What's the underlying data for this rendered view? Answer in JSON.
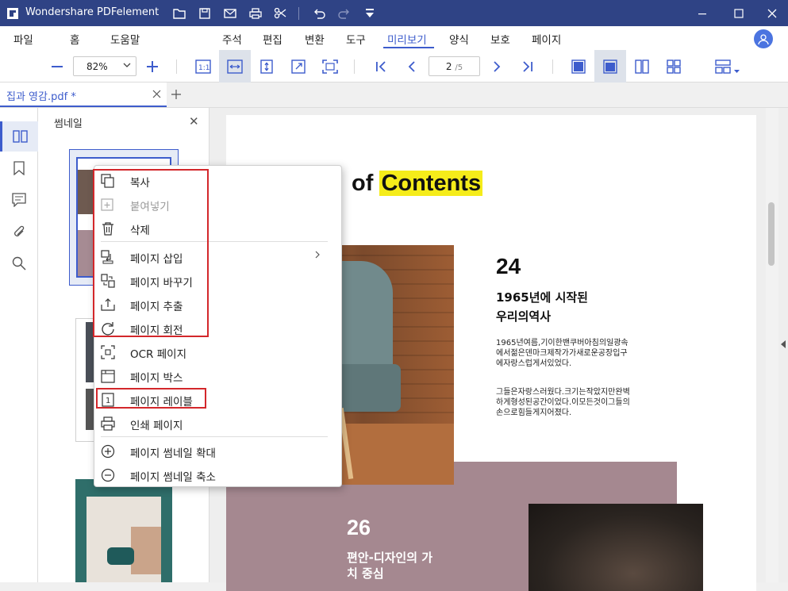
{
  "app": {
    "title": "Wondershare PDFelement"
  },
  "menu": {
    "items": [
      "파일",
      "홈",
      "도움말",
      "주석",
      "편집",
      "변환",
      "도구",
      "미리보기",
      "양식",
      "보호",
      "페이지"
    ],
    "active": "미리보기"
  },
  "toolbar": {
    "zoom": "82%",
    "page_current": "2",
    "page_total": "/5"
  },
  "tab": {
    "label": "집과 영감.pdf *"
  },
  "panel": {
    "title": "썸네일"
  },
  "context_menu": {
    "copy": "복사",
    "paste": "붙여넣기",
    "delete": "삭제",
    "insert": "페이지 삽입",
    "replace": "페이지 바꾸기",
    "extract": "페이지 추출",
    "rotate": "페이지 회전",
    "ocr": "OCR 페이지",
    "box": "페이지 박스",
    "label": "페이지 레이블",
    "print": "인쇄 페이지",
    "enlarge": "페이지 썸네일 확대",
    "shrink": "페이지 썸네일 축소"
  },
  "document": {
    "heading_prefix": "of",
    "heading_highlight": "Contents",
    "s1_num": "24",
    "s1_title_1": "1965년에 시작된",
    "s1_title_2": "우리의역사",
    "s1_p1": "1965년여름,기이한밴쿠버아침의일광속에서젊은덴마크제작가가새로운공장입구에자랑스럽게서있었다.",
    "s1_p2": "그들은자랑스러웠다.크기는작았지만완벽하게형성된공간이었다.이모든것이그들의손으로힘들게지어졌다.",
    "s2_num": "26",
    "s2_title_1": "편안-디자인의 가",
    "s2_title_2": "치 중심"
  },
  "colors": {
    "titlebar": "#2f4385",
    "accent": "#3d5ccc",
    "highlight": "#f5ec1a",
    "mauve": "#a58890",
    "redbox": "#d3272b"
  }
}
